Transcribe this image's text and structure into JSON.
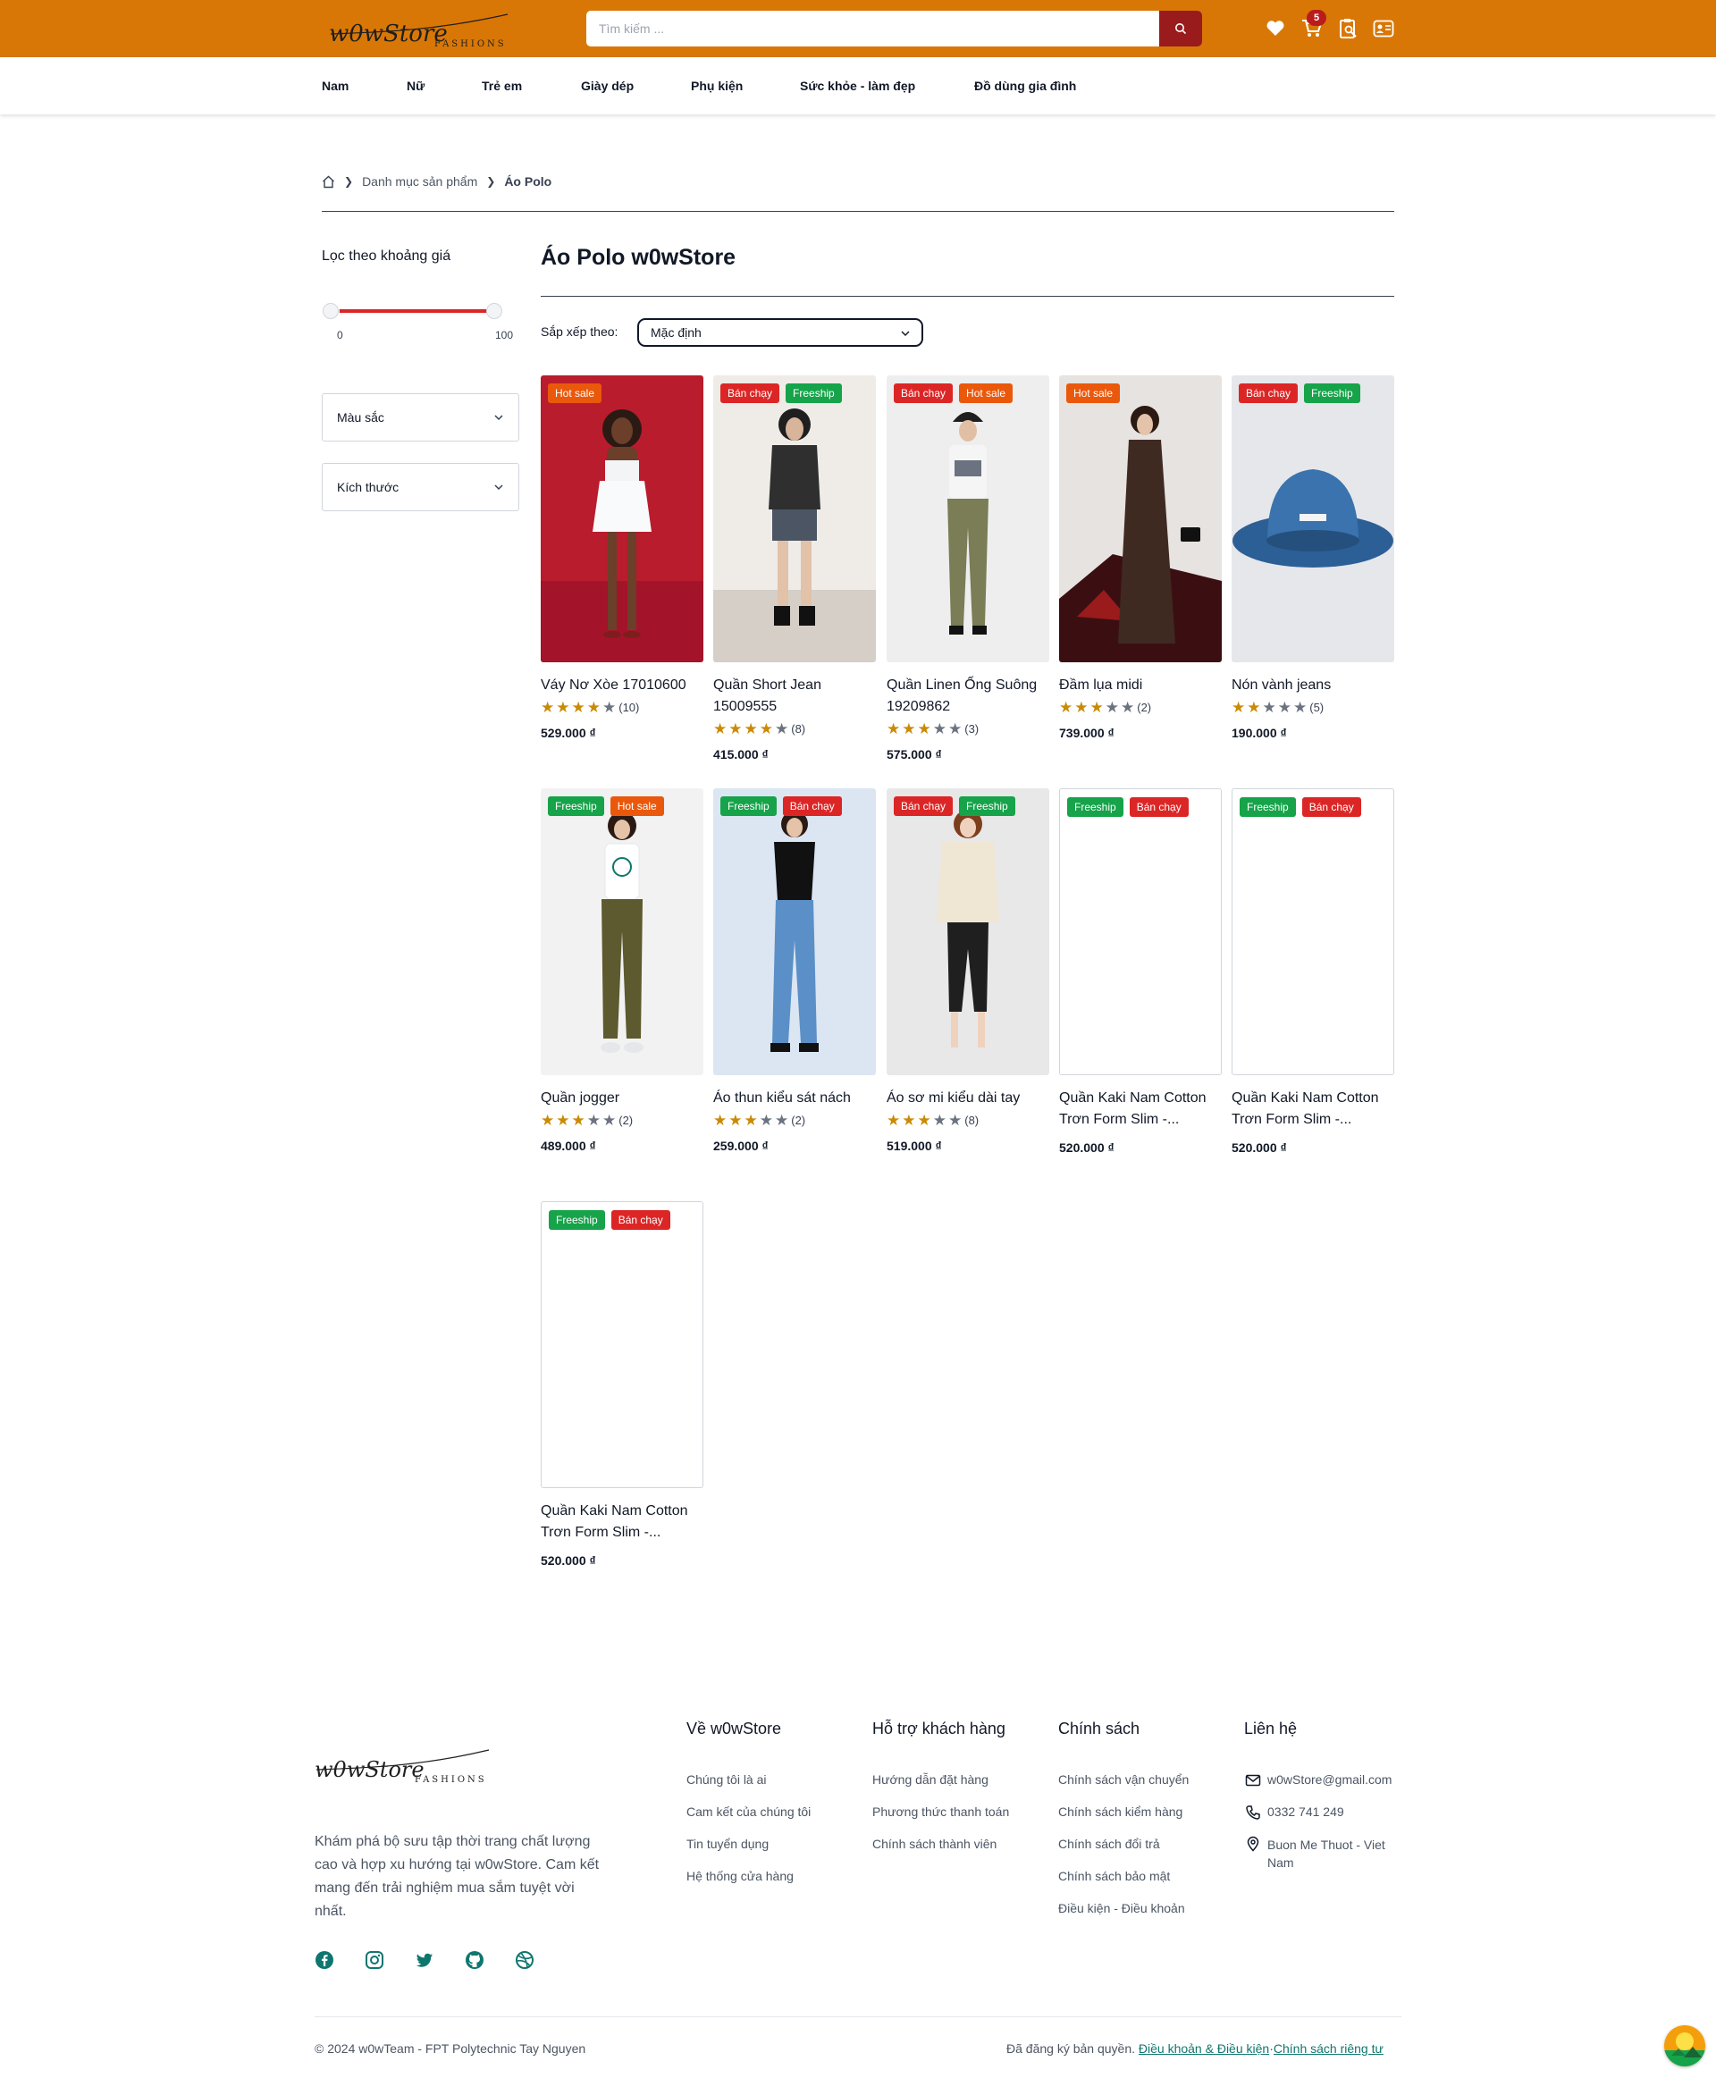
{
  "header": {
    "logo_text": "w0wStore",
    "logo_sub": "FASHIONS",
    "search_placeholder": "Tìm kiếm ...",
    "cart_count": "5",
    "accent_color": "#d97706",
    "icons": [
      "heart-icon",
      "cart-icon",
      "order-search-icon",
      "user-card-icon"
    ]
  },
  "nav": {
    "items": [
      "Nam",
      "Nữ",
      "Trẻ em",
      "Giày dép",
      "Phụ kiện",
      "Sức khỏe - làm đẹp",
      "Đồ dùng gia đình"
    ]
  },
  "breadcrumb": {
    "category": "Danh mục sản phẩm",
    "current": "Áo Polo"
  },
  "sidebar": {
    "price_filter_title": "Lọc theo khoảng giá",
    "price_min": "0",
    "price_max": "100",
    "color_filter": "Màu sắc",
    "size_filter": "Kích thước"
  },
  "main": {
    "title": "Áo Polo w0wStore",
    "sort_label": "Sắp xếp theo:",
    "sort_value": "Mặc định"
  },
  "products": [
    {
      "name": "Váy Nơ Xòe 17010600",
      "price": "529.000 ₫",
      "badges": [
        "Hot sale"
      ],
      "rating": 4,
      "reviews": "(10)"
    },
    {
      "name": "Quần Short Jean 15009555",
      "price": "415.000 ₫",
      "badges": [
        "Bán chạy",
        "Freeship"
      ],
      "rating": 4,
      "reviews": "(8)"
    },
    {
      "name": "Quần Linen Ống Suông 19209862",
      "price": "575.000 ₫",
      "badges": [
        "Bán chạy",
        "Hot sale"
      ],
      "rating": 3,
      "reviews": "(3)"
    },
    {
      "name": "Đầm lụa midi",
      "price": "739.000 ₫",
      "badges": [
        "Hot sale"
      ],
      "rating": 3,
      "reviews": "(2)"
    },
    {
      "name": "Nón vành jeans",
      "price": "190.000 ₫",
      "badges": [
        "Bán chạy",
        "Freeship"
      ],
      "rating": 2,
      "reviews": "(5)"
    },
    {
      "name": "Quần jogger",
      "price": "489.000 ₫",
      "badges": [
        "Freeship",
        "Hot sale"
      ],
      "rating": 3,
      "reviews": "(2)"
    },
    {
      "name": "Áo thun kiểu sát nách",
      "price": "259.000 ₫",
      "badges": [
        "Freeship",
        "Bán chạy"
      ],
      "rating": 3,
      "reviews": "(2)"
    },
    {
      "name": "Áo sơ mi kiểu dài tay",
      "price": "519.000 ₫",
      "badges": [
        "Bán chạy",
        "Freeship"
      ],
      "rating": 3,
      "reviews": "(8)"
    },
    {
      "name": "Quần Kaki Nam Cotton Trơn Form Slim -...",
      "price": "520.000 ₫",
      "badges": [
        "Freeship",
        "Bán chạy"
      ],
      "rating": null,
      "reviews": ""
    },
    {
      "name": "Quần Kaki Nam Cotton Trơn Form Slim -...",
      "price": "520.000 ₫",
      "badges": [
        "Freeship",
        "Bán chạy"
      ],
      "rating": null,
      "reviews": ""
    },
    {
      "name": "Quần Kaki Nam Cotton Trơn Form Slim -...",
      "price": "520.000 ₫",
      "badges": [
        "Freeship",
        "Bán chạy"
      ],
      "rating": null,
      "reviews": ""
    }
  ],
  "footer": {
    "description": "Khám phá bộ sưu tập thời trang chất lượng cao và hợp xu hướng tại w0wStore. Cam kết mang đến trải nghiệm mua sắm tuyệt vời nhất.",
    "social_icons": [
      "facebook-icon",
      "instagram-icon",
      "twitter-icon",
      "github-icon",
      "dribbble-icon"
    ],
    "columns": [
      {
        "title": "Về w0wStore",
        "links": [
          "Chúng tôi là ai",
          "Cam kết của chúng tôi",
          "Tin tuyển dụng",
          "Hệ thống cửa hàng"
        ]
      },
      {
        "title": "Hỗ trợ khách hàng",
        "links": [
          "Hướng dẫn đặt hàng",
          "Phương thức thanh toán",
          "Chính sách thành viên"
        ]
      },
      {
        "title": "Chính sách",
        "links": [
          "Chính sách vận chuyển",
          "Chính sách kiểm hàng",
          "Chính sách đổi trả",
          "Chính sách bảo mật",
          "Điều kiện - Điều khoản"
        ]
      }
    ],
    "contact": {
      "title": "Liên hệ",
      "email": "w0wStore@gmail.com",
      "phone": "0332 741 249",
      "address": "Buon Me Thuot - Viet Nam"
    },
    "copyright": "© 2024 w0wTeam - FPT Polytechnic Tay Nguyen",
    "rights_text": "Đã đăng ký bản quyền.",
    "terms_link": "Điều khoản & Điều kiện",
    "privacy_link": "Chính sách riêng tư"
  }
}
